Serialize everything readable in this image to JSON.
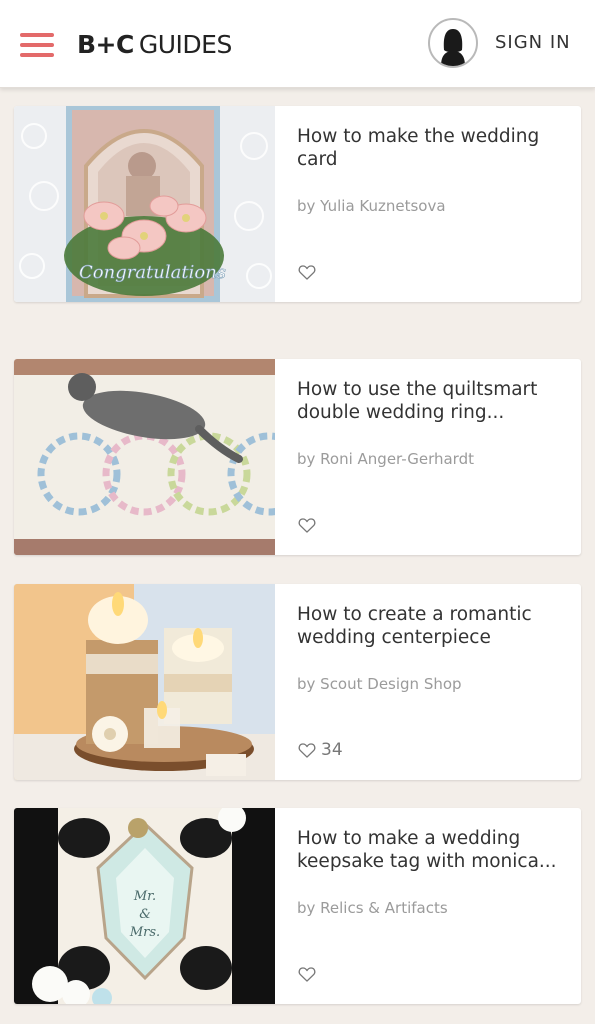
{
  "header": {
    "logo_bold": "B+C",
    "logo_light": "GUIDES",
    "signin_label": "SIGN IN",
    "accent_color": "#e36a6a"
  },
  "guides": [
    {
      "title": "How to make the wedding card",
      "author": "by Yulia Kuznetsova",
      "likes": "",
      "image": "congratulations-floral-card"
    },
    {
      "title": "How to use the quiltsmart double wedding ring...",
      "author": "by Roni Anger-Gerhardt",
      "likes": "",
      "image": "cat-on-wedding-ring-quilt"
    },
    {
      "title": "How to create a romantic wedding centerpiece",
      "author": "by Scout Design Shop",
      "likes": "34",
      "image": "candle-burlap-centerpiece"
    },
    {
      "title": "How to make a wedding keepsake tag with monica...",
      "author": "by Relics & Artifacts",
      "likes": "",
      "image": "mr-and-mrs-keepsake-tag"
    }
  ]
}
